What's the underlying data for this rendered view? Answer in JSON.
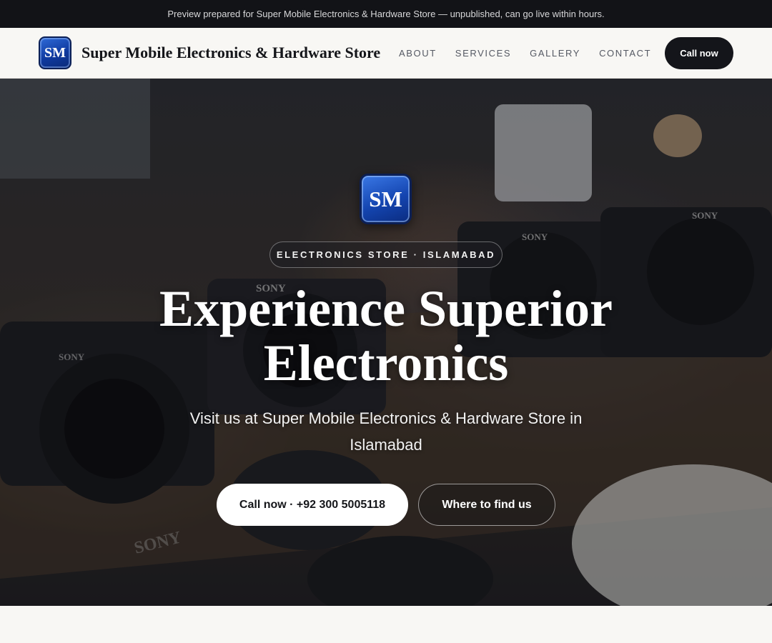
{
  "preview_bar": {
    "text": "Preview prepared for Super Mobile Electronics & Hardware Store — unpublished, can go live within hours."
  },
  "header": {
    "logo_text": "SM",
    "brand_name": "Super Mobile Electronics & Hardware Store",
    "nav": [
      {
        "label": "ABOUT"
      },
      {
        "label": "SERVICES"
      },
      {
        "label": "GALLERY"
      },
      {
        "label": "CONTACT"
      }
    ],
    "call_label": "Call now"
  },
  "hero": {
    "logo_text": "SM",
    "tag": "ELECTRONICS STORE · ISLAMABAD",
    "title": "Experience Superior Electronics",
    "subtitle": "Visit us at Super Mobile Electronics & Hardware Store in Islamabad",
    "primary_cta": "Call now · +92 300 5005118",
    "secondary_cta": "Where to find us",
    "photo_brand_text": "SONY"
  },
  "colors": {
    "topbar_bg": "#121317",
    "header_bg": "#f8f7f4",
    "brand_blue": "#1445b0",
    "dark_button": "#14151a"
  }
}
